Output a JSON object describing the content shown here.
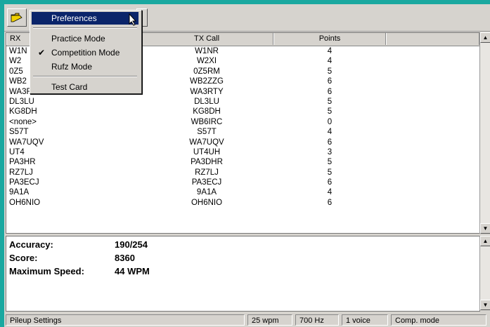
{
  "menu": {
    "items": [
      {
        "label": "Preferences",
        "highlighted": true,
        "checked": false
      },
      {
        "label": "Practice Mode",
        "highlighted": false,
        "checked": false
      },
      {
        "label": "Competition Mode",
        "highlighted": false,
        "checked": true
      },
      {
        "label": "Rufz Mode",
        "highlighted": false,
        "checked": false
      },
      {
        "label": "Test Card",
        "highlighted": false,
        "checked": false
      }
    ]
  },
  "list": {
    "columns": [
      "RX",
      "TX Call",
      "Points"
    ],
    "rows": [
      {
        "rx": "W1N",
        "tx": "W1NR",
        "points": "4"
      },
      {
        "rx": "W2",
        "tx": "W2XI",
        "points": "4"
      },
      {
        "rx": "0Z5",
        "tx": "0Z5RM",
        "points": "5"
      },
      {
        "rx": "WB2",
        "tx": "WB2ZZG",
        "points": "6"
      },
      {
        "rx": "WA3RTY",
        "tx": "WA3RTY",
        "points": "6"
      },
      {
        "rx": "DL3LU",
        "tx": "DL3LU",
        "points": "5"
      },
      {
        "rx": "KG8DH",
        "tx": "KG8DH",
        "points": "5"
      },
      {
        "rx": "<none>",
        "tx": "WB6IRC",
        "points": "0"
      },
      {
        "rx": "S57T",
        "tx": "S57T",
        "points": "4"
      },
      {
        "rx": "WA7UQV",
        "tx": "WA7UQV",
        "points": "6"
      },
      {
        "rx": "UT4",
        "tx": "UT4UH",
        "points": "3"
      },
      {
        "rx": "PA3HR",
        "tx": "PA3DHR",
        "points": "5"
      },
      {
        "rx": "RZ7LJ",
        "tx": "RZ7LJ",
        "points": "5"
      },
      {
        "rx": "PA3ECJ",
        "tx": "PA3ECJ",
        "points": "6"
      },
      {
        "rx": "9A1A",
        "tx": "9A1A",
        "points": "4"
      },
      {
        "rx": "OH6NIO",
        "tx": "OH6NIO",
        "points": "6"
      }
    ]
  },
  "stats": {
    "accuracy_label": "Accuracy:",
    "accuracy_value": "190/254",
    "score_label": "Score:",
    "score_value": "8360",
    "speed_label": "Maximum Speed:",
    "speed_value": "44 WPM"
  },
  "statusbar": {
    "settings": "Pileup Settings",
    "wpm": "25 wpm",
    "hz": "700 Hz",
    "voice": "1 voice",
    "mode": "Comp. mode"
  },
  "icons": {
    "open": "folder-open-icon",
    "check": "checkmark-icon",
    "scroll_up": "arrow-up-icon",
    "scroll_down": "arrow-down-icon"
  },
  "colors": {
    "highlight": "#0a246a",
    "background": "#1aa8a0"
  }
}
